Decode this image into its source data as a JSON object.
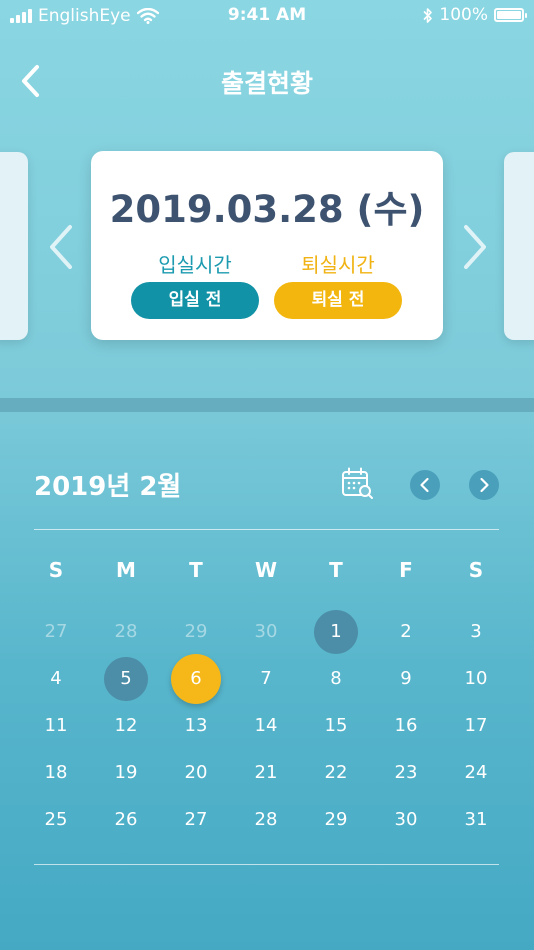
{
  "status_bar": {
    "carrier": "EnglishEye",
    "time": "9:41 AM",
    "battery": "100%"
  },
  "header": {
    "title": "출결현황"
  },
  "attendance_card": {
    "date": "2019.03.28 (수)",
    "checkin_label": "입실시간",
    "checkout_label": "퇴실시간",
    "checkin_status": "입실 전",
    "checkout_status": "퇴실 전"
  },
  "calendar": {
    "month_title": "2019년 2월",
    "weekdays": [
      "S",
      "M",
      "T",
      "W",
      "T",
      "F",
      "S"
    ],
    "days": [
      {
        "n": "27",
        "other": true
      },
      {
        "n": "28",
        "other": true
      },
      {
        "n": "29",
        "other": true
      },
      {
        "n": "30",
        "other": true
      },
      {
        "n": "1",
        "marked": true
      },
      {
        "n": "2"
      },
      {
        "n": "3"
      },
      {
        "n": "4"
      },
      {
        "n": "5",
        "marked": true
      },
      {
        "n": "6",
        "selected": true
      },
      {
        "n": "7"
      },
      {
        "n": "8"
      },
      {
        "n": "9"
      },
      {
        "n": "10"
      },
      {
        "n": "11"
      },
      {
        "n": "12"
      },
      {
        "n": "13"
      },
      {
        "n": "14"
      },
      {
        "n": "15"
      },
      {
        "n": "16"
      },
      {
        "n": "17"
      },
      {
        "n": "18"
      },
      {
        "n": "19"
      },
      {
        "n": "20"
      },
      {
        "n": "21"
      },
      {
        "n": "22"
      },
      {
        "n": "23"
      },
      {
        "n": "24"
      },
      {
        "n": "25"
      },
      {
        "n": "26"
      },
      {
        "n": "27"
      },
      {
        "n": "28"
      },
      {
        "n": "29"
      },
      {
        "n": "30"
      },
      {
        "n": "31"
      }
    ]
  },
  "icons": {
    "back": "chevron-left-icon",
    "prev_date": "chevron-left-icon",
    "next_date": "chevron-right-icon",
    "calendar": "calendar-icon",
    "prev_month": "chevron-left-icon",
    "next_month": "chevron-right-icon"
  },
  "colors": {
    "checkin": "#1292a6",
    "checkout": "#f2b60f",
    "date_text": "#3e5370",
    "selected_day": "#f6b818",
    "marked_day": "#4c8da7"
  }
}
